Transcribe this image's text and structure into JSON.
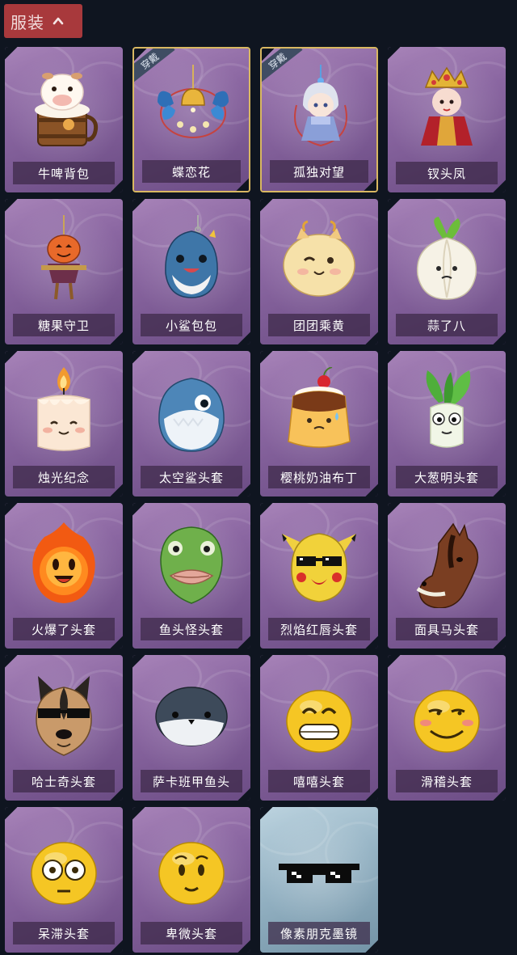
{
  "category_tab": {
    "label": "服装",
    "icon": "chevron-up-icon"
  },
  "equipped_badge": "穿戴",
  "items": [
    {
      "name": "牛啤背包",
      "icon": "cow-beer-barrel-icon",
      "equipped": false,
      "frame": "purple"
    },
    {
      "name": "蝶恋花",
      "icon": "butterfly-bell-ornament-icon",
      "equipped": true,
      "frame": "purple"
    },
    {
      "name": "孤独对望",
      "icon": "doll-pendant-icon",
      "equipped": true,
      "frame": "purple"
    },
    {
      "name": "钗头凤",
      "icon": "phoenix-crown-doll-icon",
      "equipped": false,
      "frame": "purple"
    },
    {
      "name": "糖果守卫",
      "icon": "pumpkin-scarecrow-icon",
      "equipped": false,
      "frame": "purple"
    },
    {
      "name": "小鲨包包",
      "icon": "shark-pouch-icon",
      "equipped": false,
      "frame": "purple"
    },
    {
      "name": "团团乘黄",
      "icon": "round-cat-icon",
      "equipped": false,
      "frame": "purple"
    },
    {
      "name": "蒜了八",
      "icon": "garlic-icon",
      "equipped": false,
      "frame": "purple"
    },
    {
      "name": "烛光纪念",
      "icon": "candle-icon",
      "equipped": false,
      "frame": "purple"
    },
    {
      "name": "太空鲨头套",
      "icon": "space-shark-head-icon",
      "equipped": false,
      "frame": "purple"
    },
    {
      "name": "樱桃奶油布丁",
      "icon": "cherry-pudding-icon",
      "equipped": false,
      "frame": "purple"
    },
    {
      "name": "大葱明头套",
      "icon": "scallion-head-icon",
      "equipped": false,
      "frame": "purple"
    },
    {
      "name": "火爆了头套",
      "icon": "fire-head-icon",
      "equipped": false,
      "frame": "purple"
    },
    {
      "name": "鱼头怪头套",
      "icon": "fish-head-icon",
      "equipped": false,
      "frame": "purple"
    },
    {
      "name": "烈焰红唇头套",
      "icon": "electric-mouse-head-icon",
      "equipped": false,
      "frame": "purple"
    },
    {
      "name": "面具马头套",
      "icon": "horse-head-icon",
      "equipped": false,
      "frame": "purple"
    },
    {
      "name": "哈士奇头套",
      "icon": "husky-head-icon",
      "equipped": false,
      "frame": "purple"
    },
    {
      "name": "萨卡班甲鱼头",
      "icon": "sacabambaspis-head-icon",
      "equipped": false,
      "frame": "purple"
    },
    {
      "name": "嘻嘻头套",
      "icon": "grin-emoji-head-icon",
      "equipped": false,
      "frame": "purple"
    },
    {
      "name": "滑稽头套",
      "icon": "funny-emoji-head-icon",
      "equipped": false,
      "frame": "purple"
    },
    {
      "name": "呆滞头套",
      "icon": "blank-stare-emoji-head-icon",
      "equipped": false,
      "frame": "purple"
    },
    {
      "name": "卑微头套",
      "icon": "humble-emoji-head-icon",
      "equipped": false,
      "frame": "purple"
    },
    {
      "name": "像素朋克墨镜",
      "icon": "pixel-sunglasses-icon",
      "equipped": false,
      "frame": "teal"
    }
  ]
}
